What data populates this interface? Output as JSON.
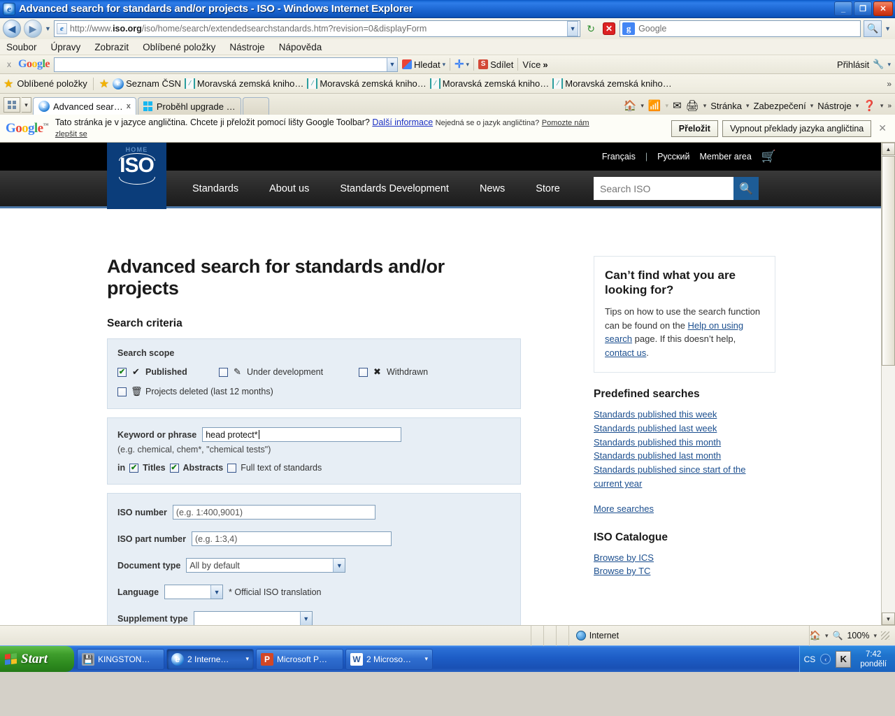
{
  "window": {
    "title": "Advanced search for standards and/or projects - ISO - Windows Internet Explorer",
    "minimize": "_",
    "maximize": "❐",
    "close": "✕"
  },
  "address": {
    "url_prefix": "http://www.",
    "url_domain": "iso.org",
    "url_suffix": "/iso/home/search/extendedsearchstandards.htm?revision=0&displayForm",
    "search_placeholder": "Google",
    "stop_label": "✕",
    "refresh_label": "↻",
    "back_label": "◀",
    "forward_label": "▶"
  },
  "menubar": {
    "items": [
      "Soubor",
      "Úpravy",
      "Zobrazit",
      "Oblíbené položky",
      "Nástroje",
      "Nápověda"
    ]
  },
  "google_toolbar": {
    "close": "x",
    "logo": "Google",
    "input_value": "",
    "search_label": "Hledat",
    "share_label": "Sdílet",
    "more_label": "Více",
    "more_chevron": "»",
    "signin_label": "Přihlásit"
  },
  "favorites_bar": {
    "label": "Oblíbené položky",
    "items": [
      {
        "label": "Seznam ČSN",
        "icon": "ie-icon"
      },
      {
        "label": "Moravská zemská kniho…",
        "icon": "teal-icon"
      },
      {
        "label": "Moravská zemská kniho…",
        "icon": "teal-icon"
      },
      {
        "label": "Moravská zemská kniho…",
        "icon": "teal-icon"
      },
      {
        "label": "Moravská zemská kniho…",
        "icon": "teal-icon"
      }
    ],
    "overflow": "»"
  },
  "tabs": {
    "quick_tabs": "quick-tabs-icon",
    "items": [
      {
        "label": "Advanced sear…",
        "active": true,
        "close": "x",
        "icon": "ie-icon"
      },
      {
        "label": "Proběhl upgrade …",
        "active": false,
        "icon": "windows-icon"
      }
    ]
  },
  "command_bar": {
    "home": "home-icon",
    "feeds": "rss-icon",
    "mail": "mail-icon",
    "print": "printer-icon",
    "page_label": "Stránka",
    "security_label": "Zabezpečení",
    "tools_label": "Nástroje",
    "help_label": "?",
    "overflow": "»"
  },
  "translate_bar": {
    "logo": "Google",
    "message": "Tato stránka je v jazyce angličtina. Chcete ji přeložit pomocí lišty Google Toolbar?",
    "more_info": "Další informace",
    "not_english": "Nejedná se o jazyk angličtina?",
    "help_us": "Pomozte nám",
    "improve": "zlepšit se",
    "translate_button": "Přeložit",
    "disable_button": "Vypnout překlady jazyka angličtina",
    "close": "✕"
  },
  "iso_header": {
    "home_label": "HOME",
    "logo_text": "ISO",
    "top_links": [
      "Français",
      "Русский",
      "Member area"
    ],
    "separator": "|",
    "cart_icon": "cart-icon",
    "nav_items": [
      "Standards",
      "About us",
      "Standards Development",
      "News",
      "Store"
    ],
    "search_placeholder": "Search ISO",
    "search_icon": "search-icon"
  },
  "page": {
    "title": "Advanced search for standards and/or projects",
    "criteria_heading": "Search criteria",
    "scope": {
      "legend": "Search scope",
      "options": [
        {
          "label": "Published",
          "checked": true,
          "icon": "✔"
        },
        {
          "label": "Under development",
          "checked": false,
          "icon": "✎"
        },
        {
          "label": "Withdrawn",
          "checked": false,
          "icon": "✖"
        },
        {
          "label": "Projects deleted (last 12 months)",
          "checked": false,
          "icon": "🗑"
        }
      ]
    },
    "keyword": {
      "label": "Keyword or phrase",
      "value": "head protect*",
      "hint": "(e.g. chemical, chem*, \"chemical tests\")",
      "in_label": "in",
      "targets": [
        {
          "label": "Titles",
          "checked": true
        },
        {
          "label": "Abstracts",
          "checked": true
        },
        {
          "label": "Full text of standards",
          "checked": false
        }
      ]
    },
    "fields": {
      "iso_number_label": "ISO number",
      "iso_number_placeholder": "(e.g. 1:400,9001)",
      "iso_part_label": "ISO part number",
      "iso_part_placeholder": "(e.g. 1:3,4)",
      "doc_type_label": "Document type",
      "doc_type_value": "All by default",
      "language_label": "Language",
      "language_value": "",
      "language_note": "* Official ISO translation",
      "supplement_label": "Supplement type"
    }
  },
  "sidebar": {
    "card_title": "Can’t find what you are looking for?",
    "card_text_1": "Tips on how to use the search function can be found on the ",
    "card_link_1": "Help on using search",
    "card_text_2": " page. If this doesn’t help, ",
    "card_link_2": "contact us",
    "card_text_3": ".",
    "predefined_heading": "Predefined searches",
    "predefined_links": [
      "Standards published this week",
      "Standards published last week",
      "Standards published this month",
      "Standards published last month",
      "Standards published since start of the current year"
    ],
    "more_searches": "More searches",
    "catalogue_heading": "ISO Catalogue",
    "catalogue_links": [
      "Browse by ICS",
      "Browse by TC"
    ]
  },
  "status_bar": {
    "zone": "Internet",
    "zone_icon": "globe-icon",
    "protect_icon": "protected-mode-icon",
    "zoom": "100%",
    "zoom_icon": "zoom-icon"
  },
  "taskbar": {
    "start_label": "Start",
    "items": [
      {
        "label": "KINGSTON…",
        "icon": "drive-icon",
        "pressed": false,
        "dropdown": false
      },
      {
        "label": "2 Interne…",
        "icon": "ie-icon",
        "pressed": true,
        "dropdown": true
      },
      {
        "label": "Microsoft P…",
        "icon": "powerpoint-icon",
        "pressed": false,
        "dropdown": false
      },
      {
        "label": "2 Microso…",
        "icon": "word-icon",
        "pressed": false,
        "dropdown": true
      }
    ],
    "language": "CS",
    "tray_arrow": "‹",
    "tray_icon": "keyboard-icon",
    "clock_time": "7:42",
    "clock_day": "pondělí"
  }
}
